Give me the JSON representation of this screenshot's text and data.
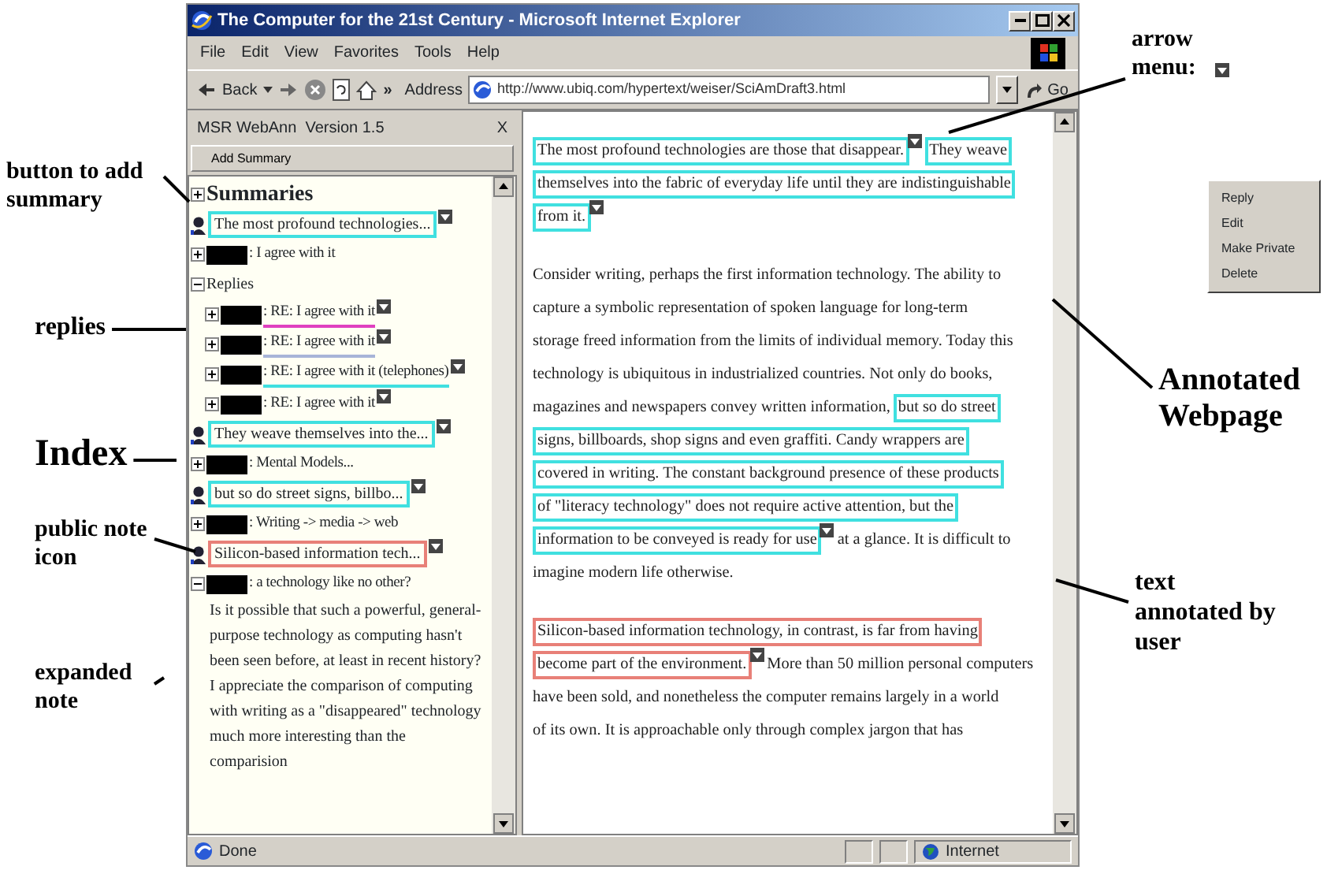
{
  "window": {
    "title": "The Computer for the 21st Century - Microsoft Internet Explorer"
  },
  "menu_bar": [
    "File",
    "Edit",
    "View",
    "Favorites",
    "Tools",
    "Help"
  ],
  "toolbar": {
    "back": "Back",
    "more": "»",
    "address_label": "Address",
    "url": "http://www.ubiq.com/hypertext/weiser/SciAmDraft3.html",
    "go": "Go"
  },
  "sidebar": {
    "title": "MSR WebAnn  Version 1.5",
    "close": "X",
    "add_button": "Add Summary",
    "tree": [
      {
        "kind": "section",
        "label": "Summaries",
        "expanded": false
      },
      {
        "kind": "note",
        "text": "The most profound technologies...",
        "color": "#40e0e0"
      },
      {
        "kind": "comment",
        "text": ": I agree with it",
        "expanded": false
      },
      {
        "kind": "group",
        "label": "Replies",
        "expanded": true,
        "children": [
          {
            "kind": "comment",
            "text": ": RE: I agree with it",
            "expanded": false,
            "color": "#e040c0"
          },
          {
            "kind": "comment",
            "text": ": RE: I agree with it",
            "expanded": false,
            "color": "#a8b4d8"
          },
          {
            "kind": "comment",
            "text": ": RE: I agree with it (telephones)",
            "expanded": false,
            "color": "#40e0e0"
          },
          {
            "kind": "comment",
            "text": ": RE: I agree with it",
            "expanded": false
          }
        ]
      },
      {
        "kind": "note",
        "text": "They weave themselves into the...",
        "color": "#40e0e0"
      },
      {
        "kind": "comment",
        "text": ": Mental Models...",
        "expanded": false
      },
      {
        "kind": "note",
        "text": "but so do street signs, billbo...",
        "color": "#40e0e0"
      },
      {
        "kind": "comment",
        "text": ": Writing -> media -> web",
        "expanded": false
      },
      {
        "kind": "note",
        "text": "Silicon-based information tech...",
        "color": "#e88078"
      },
      {
        "kind": "comment",
        "text": ": a technology like no other?",
        "expanded": true,
        "body": "Is it possible that such a powerful, general-purpose technology as computing hasn't been seen before, at least in recent history? I appreciate the comparison of computing with writing as a \"disappeared\" technology much more interesting than the comparision"
      }
    ]
  },
  "document": {
    "paragraphs": [
      {
        "lines": [
          [
            {
              "text": "The most profound technologies are those that disappear.",
              "color": "#40e0e0",
              "menu_arrow": true
            },
            {
              "text": "They weave",
              "color": "#40e0e0"
            }
          ],
          [
            {
              "text": "themselves into the fabric of everyday life until they are indistinguishable",
              "color": "#40e0e0"
            }
          ],
          [
            {
              "text": "from it.",
              "color": "#40e0e0",
              "menu_arrow": true
            }
          ]
        ]
      },
      {
        "lines": [
          [
            {
              "text": "Consider writing, perhaps the first information technology. The ability to"
            }
          ],
          [
            {
              "text": "capture a symbolic representation of spoken language for long-term"
            }
          ],
          [
            {
              "text": "storage freed information from the limits of individual memory. Today this"
            }
          ],
          [
            {
              "text": "technology is ubiquitous in industrialized countries. Not only do books,"
            }
          ],
          [
            {
              "text": "magazines and newspapers convey written information,"
            },
            {
              "text": "but so do street",
              "color": "#40e0e0"
            }
          ],
          [
            {
              "text": "signs, billboards, shop signs and even graffiti. Candy wrappers are",
              "color": "#40e0e0"
            }
          ],
          [
            {
              "text": "covered in writing. The constant background presence of these products",
              "color": "#40e0e0"
            }
          ],
          [
            {
              "text": "of \"literacy technology\" does not require active attention, but the",
              "color": "#40e0e0"
            }
          ],
          [
            {
              "text": "information to be conveyed is ready for use",
              "color": "#40e0e0",
              "menu_arrow": true
            },
            {
              "text": "at a glance. It is difficult to"
            }
          ],
          [
            {
              "text": "imagine modern life otherwise."
            }
          ]
        ]
      },
      {
        "lines": [
          [
            {
              "text": "Silicon-based information technology, in contrast, is far from having",
              "color": "#e88078"
            }
          ],
          [
            {
              "text": "become part of the environment.",
              "color": "#e88078",
              "menu_arrow": true
            },
            {
              "text": "More than 50 million personal computers"
            }
          ],
          [
            {
              "text": "have been sold, and nonetheless the computer remains largely in a world"
            }
          ],
          [
            {
              "text": "of its own. It is approachable only through complex jargon that has"
            }
          ]
        ]
      }
    ]
  },
  "status_bar": {
    "text": "Done",
    "zone": "Internet"
  },
  "callouts": [
    "button to add summary",
    "replies",
    "Index",
    "public note icon",
    "expanded note",
    "arrow menu:",
    "Annotated Webpage",
    "text annotated by user"
  ],
  "popup_menu": {
    "items": [
      "Reply",
      "Edit",
      "Make Private",
      "Delete"
    ]
  }
}
